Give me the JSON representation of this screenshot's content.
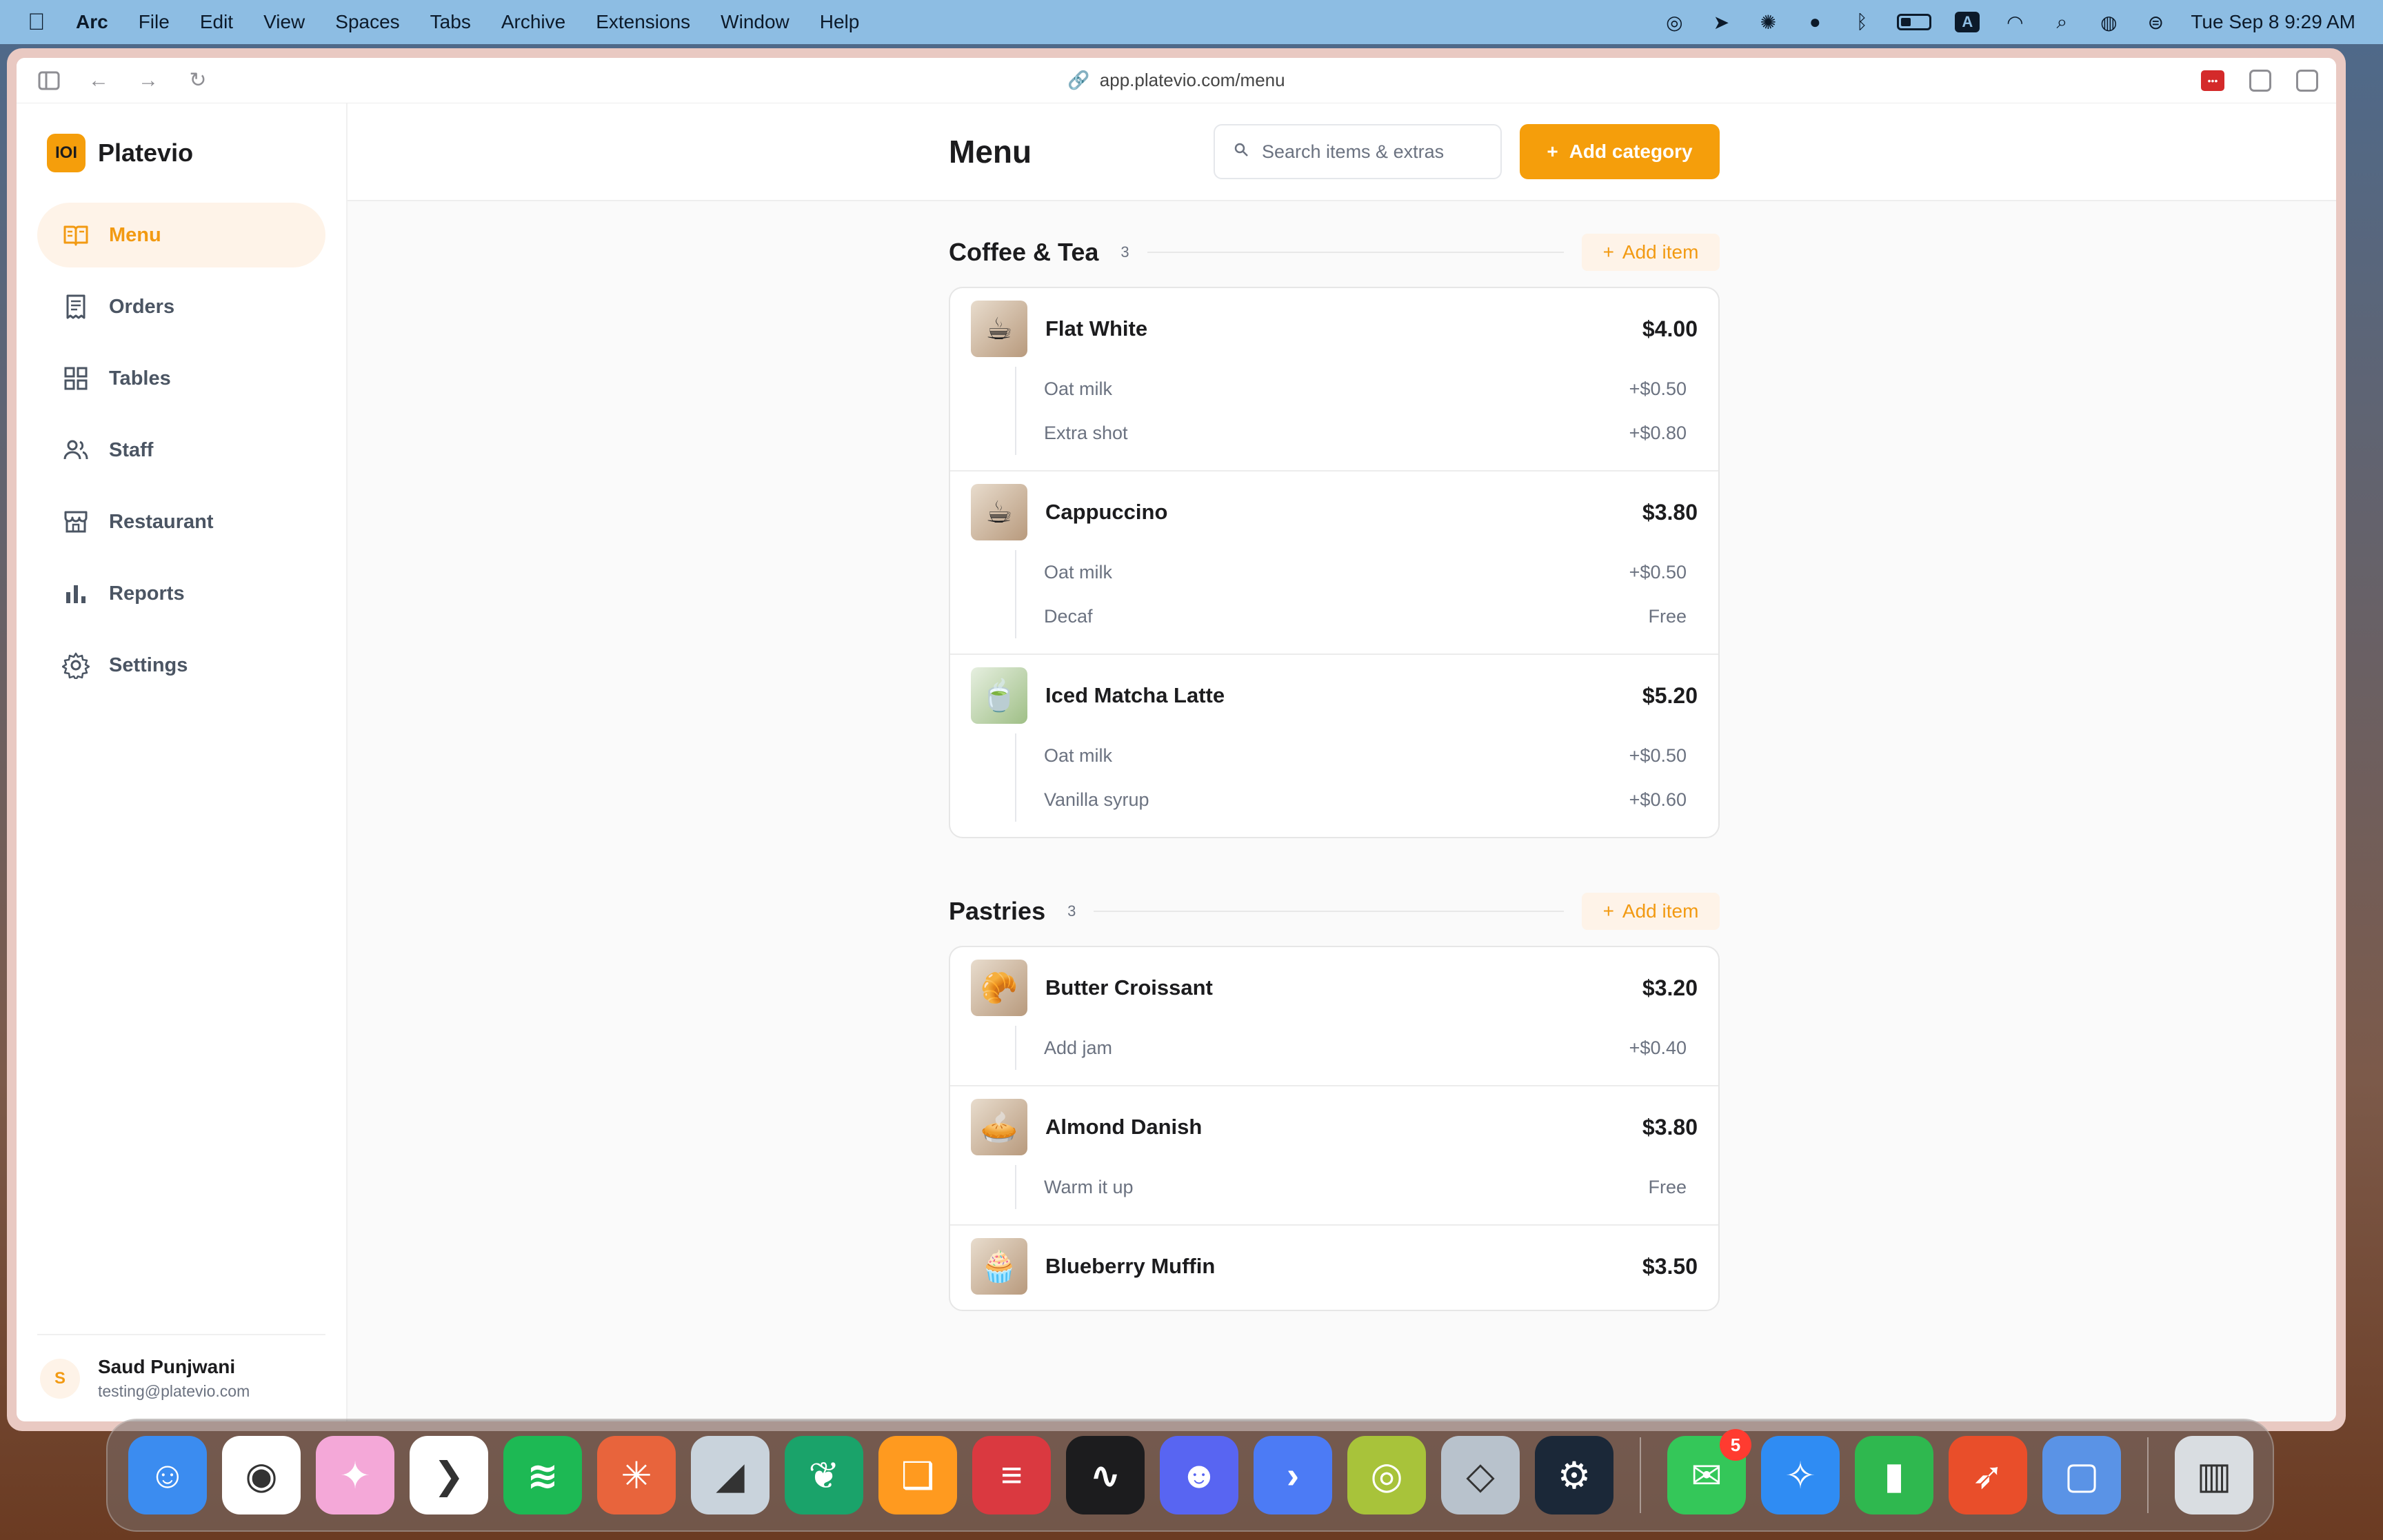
{
  "menubar": {
    "apple_icon": "apple-icon",
    "app_name": "Arc",
    "items": [
      "File",
      "Edit",
      "View",
      "Spaces",
      "Tabs",
      "Archive",
      "Extensions",
      "Window",
      "Help"
    ],
    "keyboard_badge": "A",
    "clock": "Tue Sep 8  9:29 AM"
  },
  "browser": {
    "url": "app.platevio.com/menu"
  },
  "sidebar": {
    "brand": "Platevio",
    "brand_logo_text": "IOI",
    "items": [
      {
        "label": "Menu",
        "icon": "book-open-icon",
        "active": true
      },
      {
        "label": "Orders",
        "icon": "receipt-icon",
        "active": false
      },
      {
        "label": "Tables",
        "icon": "grid-icon",
        "active": false
      },
      {
        "label": "Staff",
        "icon": "users-icon",
        "active": false
      },
      {
        "label": "Restaurant",
        "icon": "storefront-icon",
        "active": false
      },
      {
        "label": "Reports",
        "icon": "bar-chart-icon",
        "active": false
      },
      {
        "label": "Settings",
        "icon": "gear-icon",
        "active": false
      }
    ],
    "user": {
      "initial": "S",
      "name": "Saud Punjwani",
      "email": "testing@platevio.com"
    }
  },
  "header": {
    "title": "Menu",
    "search_placeholder": "Search items & extras",
    "add_category": "Add category"
  },
  "add_item_label": "Add item",
  "categories": [
    {
      "name": "Coffee & Tea",
      "count": "3",
      "items": [
        {
          "name": "Flat White",
          "price": "$4.00",
          "thumb": "coffee-cup-icon",
          "modifiers": [
            {
              "name": "Oat milk",
              "price": "+$0.50"
            },
            {
              "name": "Extra shot",
              "price": "+$0.80"
            }
          ]
        },
        {
          "name": "Cappuccino",
          "price": "$3.80",
          "thumb": "coffee-cup-icon",
          "modifiers": [
            {
              "name": "Oat milk",
              "price": "+$0.50"
            },
            {
              "name": "Decaf",
              "price": "Free"
            }
          ]
        },
        {
          "name": "Iced Matcha Latte",
          "price": "$5.20",
          "thumb": "iced-drink-icon",
          "modifiers": [
            {
              "name": "Oat milk",
              "price": "+$0.50"
            },
            {
              "name": "Vanilla syrup",
              "price": "+$0.60"
            }
          ]
        }
      ]
    },
    {
      "name": "Pastries",
      "count": "3",
      "items": [
        {
          "name": "Butter Croissant",
          "price": "$3.20",
          "thumb": "croissant-icon",
          "modifiers": [
            {
              "name": "Add jam",
              "price": "+$0.40"
            }
          ]
        },
        {
          "name": "Almond Danish",
          "price": "$3.80",
          "thumb": "danish-icon",
          "modifiers": [
            {
              "name": "Warm it up",
              "price": "Free"
            }
          ]
        },
        {
          "name": "Blueberry Muffin",
          "price": "$3.50",
          "thumb": "muffin-icon",
          "modifiers": []
        }
      ]
    }
  ],
  "dock": {
    "apps": [
      {
        "name": "finder-app-icon",
        "color": "#3b8cf0",
        "glyph": "☺"
      },
      {
        "name": "chrome-app-icon",
        "color": "#ffffff",
        "glyph": "◉"
      },
      {
        "name": "design-app-icon",
        "color": "#f4a8d8",
        "glyph": "✦"
      },
      {
        "name": "vscode-app-icon",
        "color": "#ffffff",
        "glyph": "❯"
      },
      {
        "name": "spotify-app-icon",
        "color": "#1db954",
        "glyph": "≋"
      },
      {
        "name": "claude-app-icon",
        "color": "#e8643c",
        "glyph": "✳"
      },
      {
        "name": "cursor-app-icon",
        "color": "#c9d3dc",
        "glyph": "◢"
      },
      {
        "name": "mastodon-app-icon",
        "color": "#1aa36a",
        "glyph": "❦"
      },
      {
        "name": "books-app-icon",
        "color": "#ff9a1f",
        "glyph": "❑"
      },
      {
        "name": "expressvpn-app-icon",
        "color": "#da3940",
        "glyph": "≡"
      },
      {
        "name": "stocks-app-icon",
        "color": "#1c1c1e",
        "glyph": "∿"
      },
      {
        "name": "discord-app-icon",
        "color": "#5865f2",
        "glyph": "☻"
      },
      {
        "name": "terminal-app-icon",
        "color": "#4c7bf5",
        "glyph": "›"
      },
      {
        "name": "spiral-app-icon",
        "color": "#a8c33a",
        "glyph": "◎"
      },
      {
        "name": "network-app-icon",
        "color": "#b8c2cc",
        "glyph": "◇"
      },
      {
        "name": "steam-app-icon",
        "color": "#1b2838",
        "glyph": "⚙"
      },
      {
        "name": "messages-app-icon",
        "color": "#34c759",
        "glyph": "✉",
        "badge": "5"
      },
      {
        "name": "safari-app-icon",
        "color": "#2f8cf3",
        "glyph": "✧"
      },
      {
        "name": "numbers-app-icon",
        "color": "#2fb84f",
        "glyph": "▮"
      },
      {
        "name": "rocket-app-icon",
        "color": "#e94e2a",
        "glyph": "➶"
      },
      {
        "name": "jar-app-icon",
        "color": "#5a93e6",
        "glyph": "▢"
      },
      {
        "name": "trash-app-icon",
        "color": "#d9dde1",
        "glyph": "▥"
      }
    ]
  }
}
